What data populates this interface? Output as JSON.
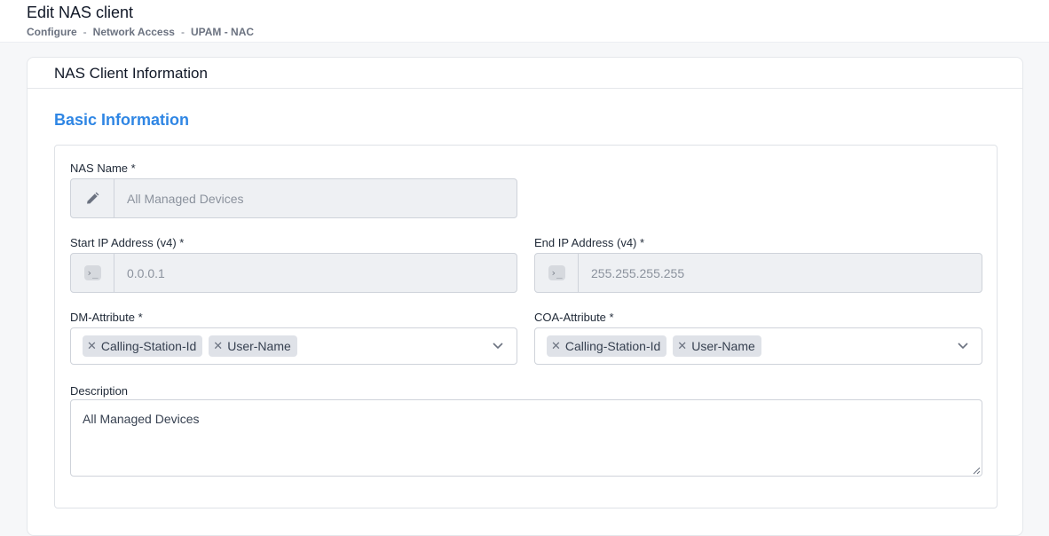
{
  "header": {
    "title": "Edit NAS client",
    "breadcrumb": [
      "Configure",
      "Network Access",
      "UPAM - NAC"
    ],
    "separator": "-"
  },
  "card": {
    "title": "NAS Client Information",
    "section_title": "Basic Information"
  },
  "form": {
    "nas_name": {
      "label": "NAS Name *",
      "value": "All Managed Devices",
      "icon": "pencil-icon"
    },
    "start_ip": {
      "label": "Start IP Address (v4) *",
      "value": "0.0.0.1",
      "icon": "terminal-icon"
    },
    "end_ip": {
      "label": "End IP Address (v4) *",
      "value": "255.255.255.255",
      "icon": "terminal-icon"
    },
    "dm_attribute": {
      "label": "DM-Attribute *",
      "tags": [
        "Calling-Station-Id",
        "User-Name"
      ]
    },
    "coa_attribute": {
      "label": "COA-Attribute *",
      "tags": [
        "Calling-Station-Id",
        "User-Name"
      ]
    },
    "description": {
      "label": "Description",
      "value": "All Managed Devices"
    }
  },
  "colors": {
    "accent": "#2f86e4",
    "disabled_bg": "#eef0f3",
    "tag_bg": "#dfe2e8"
  }
}
